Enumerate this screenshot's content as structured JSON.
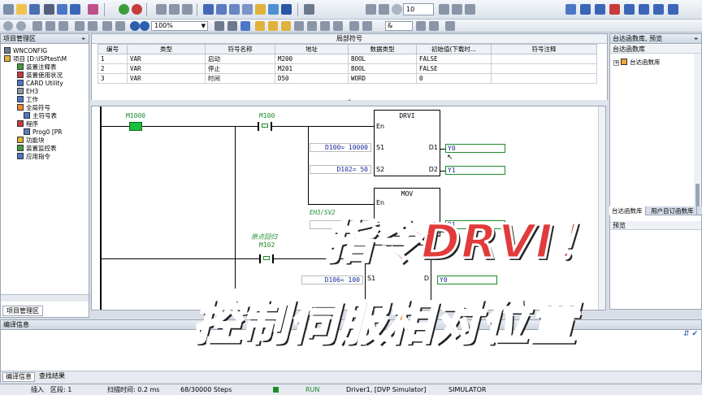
{
  "toolbar": {
    "zoom_value": "100%",
    "spin_value": "10",
    "dd_value": "&"
  },
  "project_panel": {
    "title": "项目管理区",
    "pin": "⌖",
    "items": [
      {
        "label": "WNCONFIG",
        "indent": 0
      },
      {
        "label": "项目 [D:\\ISPtest\\M",
        "indent": 0
      },
      {
        "label": "装置注释表",
        "indent": 2
      },
      {
        "label": "装置使用状况",
        "indent": 2
      },
      {
        "label": "CARD Utility",
        "indent": 2
      },
      {
        "label": "EH3",
        "indent": 2
      },
      {
        "label": "工作",
        "indent": 2
      },
      {
        "label": "全局符号",
        "indent": 2
      },
      {
        "label": "主符号表",
        "indent": 3
      },
      {
        "label": "程序",
        "indent": 2
      },
      {
        "label": "Prog0 [PR",
        "indent": 3
      },
      {
        "label": "功能块",
        "indent": 2
      },
      {
        "label": "装置监控表",
        "indent": 2
      },
      {
        "label": "应用指令",
        "indent": 2
      }
    ],
    "bottom_tab": "项目管理区"
  },
  "local_symbols": {
    "title": "局部符号",
    "columns": [
      "编号",
      "类型",
      "符号名称",
      "地址",
      "数据类型",
      "初始值(下载时...",
      "符号注释"
    ],
    "rows": [
      [
        "1",
        "VAR",
        "启动",
        "M200",
        "BOOL",
        "FALSE",
        ""
      ],
      [
        "2",
        "VAR",
        "停止",
        "M201",
        "BOOL",
        "FALSE",
        ""
      ],
      [
        "3",
        "VAR",
        "时间",
        "D50",
        "WORD",
        "0",
        ""
      ]
    ]
  },
  "ladder": {
    "contact1": "M1000",
    "contact2": "M100",
    "drvi": {
      "name": "DRVI",
      "en": "En",
      "s1": "S1",
      "s2": "S2",
      "d1": "D1",
      "d2": "D2",
      "s1_val": "D100= 10000",
      "s2_val": "D102= 50",
      "d1_out": "Y0",
      "d2_out": "Y1"
    },
    "mov": {
      "name": "MOV",
      "en": "En",
      "s": "S",
      "d": "D",
      "d_out": "D1",
      "s_val": "EH3/SV2"
    },
    "comment_home": "原点回归",
    "contact3": "M102",
    "box3": {
      "s1": "S1",
      "d": "D",
      "s1_val": "D106= 100",
      "d_out": "Y0"
    }
  },
  "right_panel": {
    "title": "台达函数库, 预览",
    "header": "台达函数库",
    "tree_item": "台达函数库",
    "tab1": "台达函数库",
    "tab2": "用户自订函数库",
    "preview": "预览"
  },
  "compile_panel": {
    "title": "编译信息",
    "tab1": "编译信息",
    "tab2": "查找结果"
  },
  "statusbar": {
    "mode": "插入",
    "section": "区段: 1",
    "scan": "扫描时间: 0.2 ms",
    "steps": "68/30000 Steps",
    "run": "RUN",
    "driver": "Driver1, [DVP Simulator]",
    "sim": "SIMULATOR"
  },
  "overlay": {
    "line1": "指令DRVI！",
    "line2a": "控制伺服",
    "line2b": "相对位置"
  },
  "colors": {
    "accent_red": "#e23b3b",
    "accent_orange": "#f1892b",
    "ladder_green": "#1c8c2c"
  }
}
